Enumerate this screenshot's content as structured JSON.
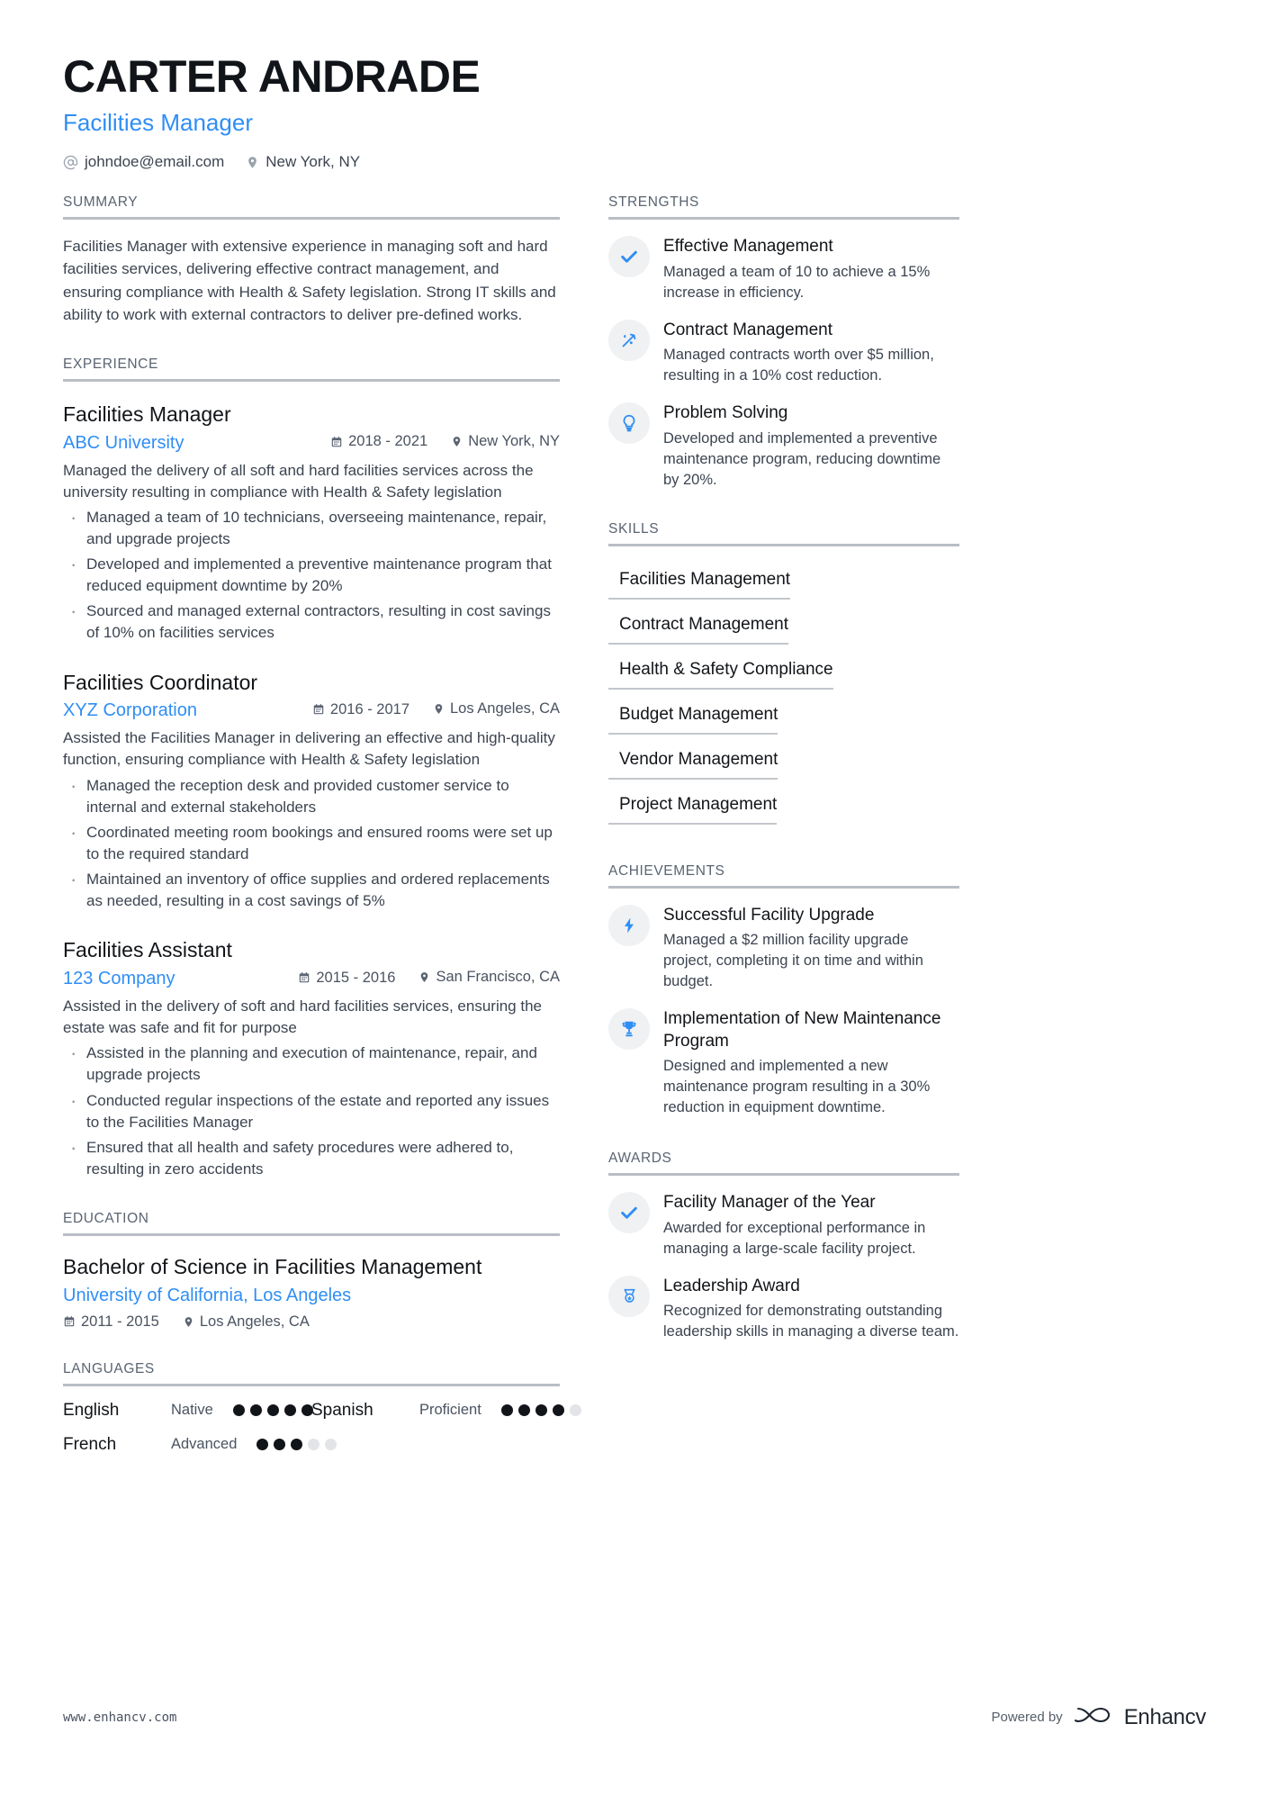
{
  "theme": {
    "accent": "#2f8ef4",
    "text": "#2e3642",
    "muted": "#5a6472",
    "rule": "#b9bec4",
    "icon_bg": "#f0f1f2"
  },
  "header": {
    "name": "CARTER ANDRADE",
    "job_title": "Facilities Manager",
    "email": "johndoe@email.com",
    "email_icon": "at-sign-icon",
    "location": "New York, NY",
    "location_icon": "map-pin-icon"
  },
  "summary": {
    "heading": "SUMMARY",
    "text": "Facilities Manager with extensive experience in managing soft and hard facilities services, delivering effective contract management, and ensuring compliance with Health & Safety legislation. Strong IT skills and ability to work with external contractors to deliver pre-defined works."
  },
  "experience": {
    "heading": "EXPERIENCE",
    "items": [
      {
        "title": "Facilities Manager",
        "company": "ABC University",
        "date": "2018 - 2021",
        "location": "New York, NY",
        "description": "Managed the delivery of all soft and hard facilities services across the university resulting in compliance with Health & Safety legislation",
        "bullets": [
          "Managed a team of 10 technicians, overseeing maintenance, repair, and upgrade projects",
          "Developed and implemented a preventive maintenance program that reduced equipment downtime by 20%",
          "Sourced and managed external contractors, resulting in cost savings of 10% on facilities services"
        ]
      },
      {
        "title": "Facilities Coordinator",
        "company": "XYZ Corporation",
        "date": "2016 - 2017",
        "location": "Los Angeles, CA",
        "description": "Assisted the Facilities Manager in delivering an effective and high-quality function, ensuring compliance with Health & Safety legislation",
        "bullets": [
          "Managed the reception desk and provided customer service to internal and external stakeholders",
          "Coordinated meeting room bookings and ensured rooms were set up to the required standard",
          "Maintained an inventory of office supplies and ordered replacements as needed, resulting in a cost savings of 5%"
        ]
      },
      {
        "title": "Facilities Assistant",
        "company": "123 Company",
        "date": "2015 - 2016",
        "location": "San Francisco, CA",
        "description": "Assisted in the delivery of soft and hard facilities services, ensuring the estate was safe and fit for purpose",
        "bullets": [
          "Assisted in the planning and execution of maintenance, repair, and upgrade projects",
          "Conducted regular inspections of the estate and reported any issues to the Facilities Manager",
          "Ensured that all health and safety procedures were adhered to, resulting in zero accidents"
        ]
      }
    ]
  },
  "education": {
    "heading": "EDUCATION",
    "items": [
      {
        "degree": "Bachelor of Science in Facilities Management",
        "school": "University of California, Los Angeles",
        "date": "2011 - 2015",
        "location": "Los Angeles, CA"
      }
    ]
  },
  "languages": {
    "heading": "LANGUAGES",
    "items": [
      {
        "name": "English",
        "level": "Native",
        "filled": 5,
        "total": 5
      },
      {
        "name": "Spanish",
        "level": "Proficient",
        "filled": 4,
        "total": 5
      },
      {
        "name": "French",
        "level": "Advanced",
        "filled": 3,
        "total": 5
      }
    ]
  },
  "strengths": {
    "heading": "STRENGTHS",
    "items": [
      {
        "icon": "check-icon",
        "title": "Effective Management",
        "description": "Managed a team of 10 to achieve a 15% increase in efficiency."
      },
      {
        "icon": "magic-wand-icon",
        "title": "Contract Management",
        "description": "Managed contracts worth over $5 million, resulting in a 10% cost reduction."
      },
      {
        "icon": "lightbulb-icon",
        "title": "Problem Solving",
        "description": "Developed and implemented a preventive maintenance program, reducing downtime by 20%."
      }
    ]
  },
  "skills": {
    "heading": "SKILLS",
    "items": [
      "Facilities Management",
      "Contract Management",
      "Health & Safety Compliance",
      "Budget Management",
      "Vendor Management",
      "Project Management"
    ]
  },
  "achievements": {
    "heading": "ACHIEVEMENTS",
    "items": [
      {
        "icon": "lightning-bolt-icon",
        "title": "Successful Facility Upgrade",
        "description": "Managed a $2 million facility upgrade project, completing it on time and within budget."
      },
      {
        "icon": "trophy-icon",
        "title": "Implementation of New Maintenance Program",
        "description": "Designed and implemented a new maintenance program resulting in a 30% reduction in equipment downtime."
      }
    ]
  },
  "awards": {
    "heading": "AWARDS",
    "items": [
      {
        "icon": "check-icon",
        "title": "Facility Manager of the Year",
        "description": "Awarded for exceptional performance in managing a large-scale facility project."
      },
      {
        "icon": "medal-icon",
        "title": "Leadership Award",
        "description": "Recognized for demonstrating outstanding leadership skills in managing a diverse team."
      }
    ]
  },
  "footer": {
    "url": "www.enhancv.com",
    "powered_by": "Powered by",
    "brand": "Enhancv",
    "brand_logo_icon": "enhancv-logo-icon"
  }
}
